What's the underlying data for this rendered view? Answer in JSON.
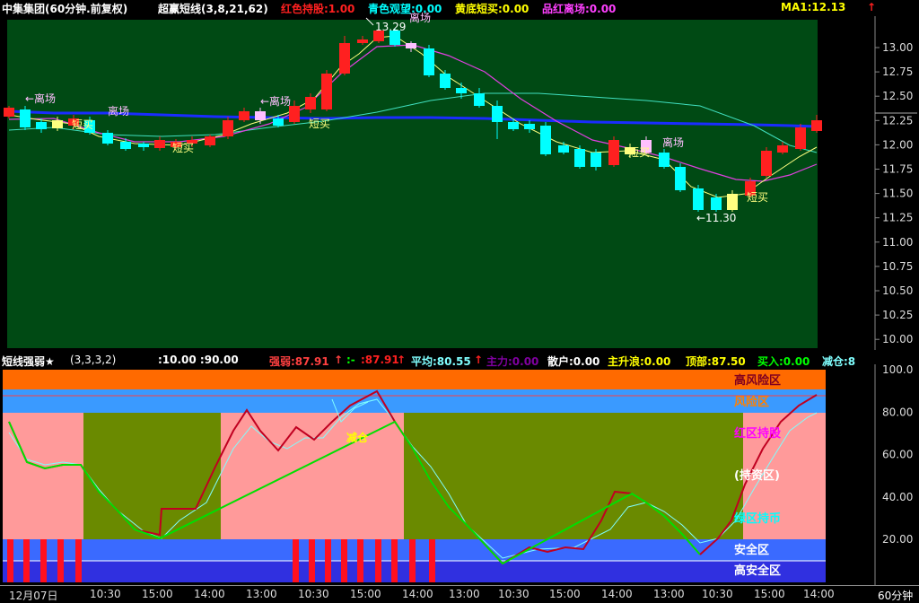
{
  "top_header": {
    "title": "中集集团(60分钟.前复权)",
    "indicator": "超赢短线(3,8,21,62)",
    "red_hold": "红色持股:1.00",
    "cyan_watch": "青色观望:0.00",
    "yellow_buy": "黄底短买:0.00",
    "magenta_exit": "品红离场:0.00",
    "ma": "MA1:12.13",
    "arrow": "↑",
    "colors": {
      "red": "#ff2020",
      "cyan": "#00ffff",
      "yellow": "#ffff00",
      "magenta": "#ff40ff",
      "ma": "#ffff00"
    }
  },
  "main_chart": {
    "price_axis": [
      "13.00",
      "12.75",
      "12.50",
      "12.25",
      "12.00",
      "11.75",
      "11.50",
      "11.25",
      "11.00",
      "10.75",
      "10.50",
      "10.25",
      "10.00"
    ],
    "annotations": {
      "high": "13.29",
      "low": "←11.30",
      "exit1": "←离场",
      "exit2": "离场",
      "exit3": "←离场",
      "exit4": "离场",
      "exit_top": "离场",
      "buy1": "短买",
      "buy2": "短买",
      "buy3": "短买",
      "buy4": "短买",
      "buy5": "短买"
    }
  },
  "sub_header": {
    "name": "短线强弱★",
    "params": "(3,3,3,2)",
    "levels": ":10.00 :90.00",
    "strength": "强弱:87.91",
    "strength_arrow": "↑",
    "minus": ":-",
    "minus_val": ":87.91",
    "minus_arrow": "↑",
    "avg": "平均:80.55",
    "avg_arrow": "↑",
    "main_force": "主力:0.00",
    "retail": "散户:0.00",
    "main_rise": "主升浪:0.00",
    "top": "顶部:87.50",
    "buy": "买入:0.00",
    "reduce": "减仓:8"
  },
  "sub_chart": {
    "axis": [
      "100.0",
      "80.00",
      "60.00",
      "40.00",
      "20.00"
    ],
    "zones": {
      "high_risk": "高风险区",
      "risk": "风险区",
      "red_hold": "红区持股",
      "wait": "(持资区)",
      "green_wait": "绿区持币",
      "safe": "安全区",
      "high_safe": "高安全区",
      "reduce_mark": "减仓"
    }
  },
  "time_axis": {
    "labels": [
      "12月07日",
      "10:30",
      "15:00",
      "14:00",
      "13:00",
      "10:30",
      "15:00",
      "14:00",
      "13:00",
      "10:30",
      "15:00",
      "14:00",
      "13:00",
      "10:30",
      "15:00",
      "14:00"
    ],
    "period": "60分钟"
  }
}
